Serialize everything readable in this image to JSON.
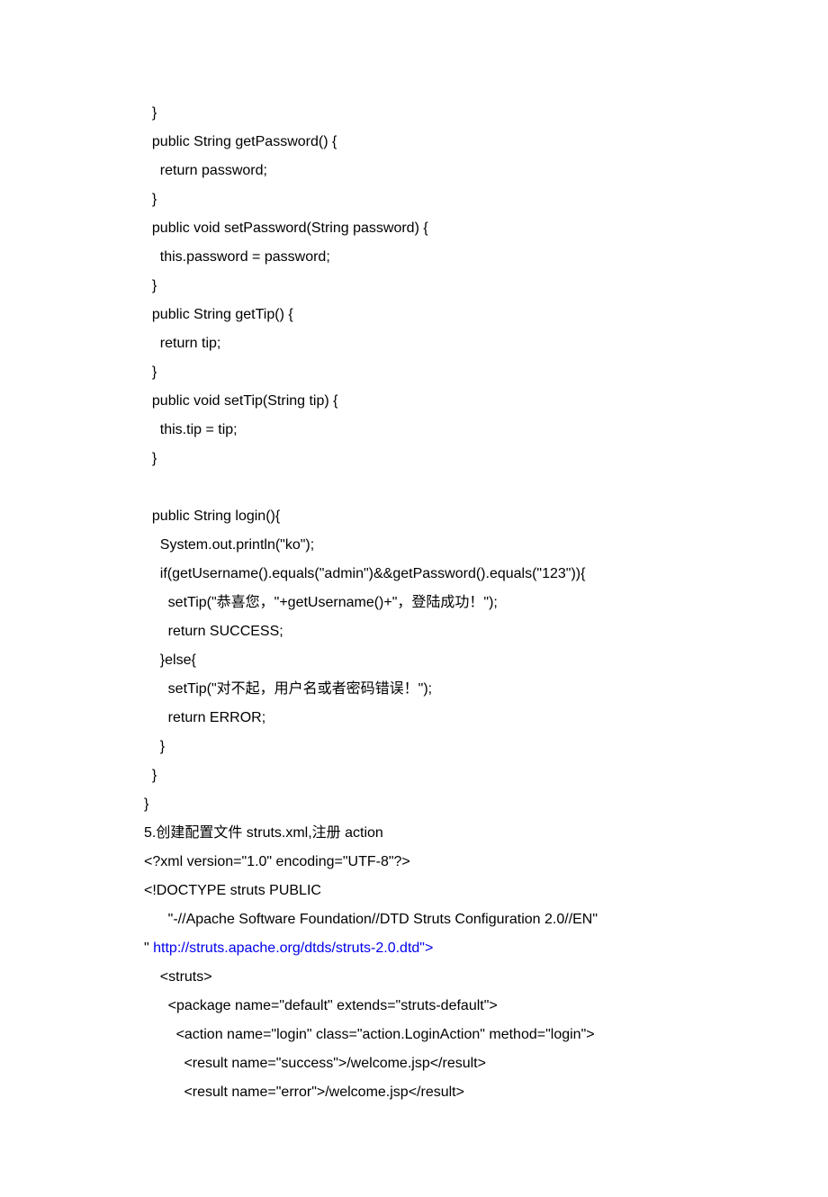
{
  "lines": [
    {
      "indent": 1,
      "text": "}"
    },
    {
      "indent": 1,
      "text": "public String getPassword() {"
    },
    {
      "indent": 2,
      "text": "return password;"
    },
    {
      "indent": 1,
      "text": "}"
    },
    {
      "indent": 1,
      "text": "public void setPassword(String password) {"
    },
    {
      "indent": 2,
      "text": "this.password = password;"
    },
    {
      "indent": 1,
      "text": "}"
    },
    {
      "indent": 1,
      "text": "public String getTip() {"
    },
    {
      "indent": 2,
      "text": "return tip;"
    },
    {
      "indent": 1,
      "text": "}"
    },
    {
      "indent": 1,
      "text": "public void setTip(String tip) {"
    },
    {
      "indent": 2,
      "text": "this.tip = tip;"
    },
    {
      "indent": 1,
      "text": "}"
    },
    {
      "indent": 1,
      "text": ""
    },
    {
      "indent": 1,
      "text": "public String login(){"
    },
    {
      "indent": 2,
      "text": "System.out.println(\"ko\");"
    },
    {
      "indent": 2,
      "text": "if(getUsername().equals(\"admin\")&&getPassword().equals(\"123\")){"
    },
    {
      "indent": 3,
      "text": "setTip(\"恭喜您，\"+getUsername()+\"，登陆成功！\");"
    },
    {
      "indent": 3,
      "text": "return SUCCESS;"
    },
    {
      "indent": 2,
      "text": "}else{"
    },
    {
      "indent": 3,
      "text": "setTip(\"对不起，用户名或者密码错误！\");"
    },
    {
      "indent": 3,
      "text": "return ERROR;"
    },
    {
      "indent": 2,
      "text": "}"
    },
    {
      "indent": 1,
      "text": "}"
    },
    {
      "indent": 0,
      "text": "}"
    },
    {
      "indent": 0,
      "text": "5.创建配置文件 struts.xml,注册 action"
    },
    {
      "indent": 0,
      "text": "<?xml version=\"1.0\" encoding=\"UTF-8\"?>"
    },
    {
      "indent": 0,
      "text": "<!DOCTYPE struts PUBLIC"
    },
    {
      "indent": 0,
      "text": "      \"-//Apache Software Foundation//DTD Struts Configuration 2.0//EN\""
    },
    {
      "indent": 0,
      "prefix": "\" ",
      "link": "http://struts.apache.org/dtds/struts-2.0.dtd\">",
      "text": ""
    },
    {
      "indent": 0,
      "text": "    <struts>"
    },
    {
      "indent": 0,
      "text": "      <package name=\"default\" extends=\"struts-default\">"
    },
    {
      "indent": 0,
      "text": "        <action name=\"login\" class=\"action.LoginAction\" method=\"login\">"
    },
    {
      "indent": 0,
      "text": "          <result name=\"success\">/welcome.jsp</result>"
    },
    {
      "indent": 0,
      "text": "          <result name=\"error\">/welcome.jsp</result>"
    }
  ]
}
